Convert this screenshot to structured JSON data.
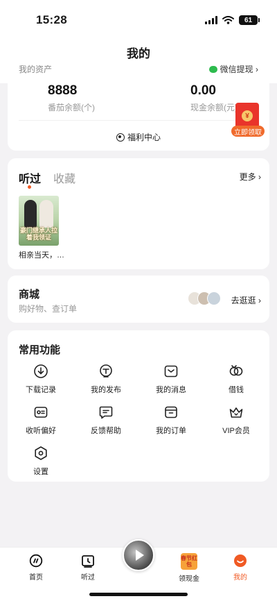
{
  "status": {
    "time": "15:28",
    "battery": "61"
  },
  "nav": {
    "title": "我的"
  },
  "assets": {
    "label": "我的资产",
    "wechat_withdraw": "微信提现 ›",
    "coins": {
      "value": "8888",
      "label": "番茄余额(个)"
    },
    "cash": {
      "value": "0.00",
      "label": "现金余额(元)"
    },
    "welfare": "福利中心"
  },
  "redpacket": {
    "coin": "¥",
    "button": "立即领取"
  },
  "listen": {
    "tabs": [
      "听过",
      "收藏"
    ],
    "more": "更多 ›",
    "cover_title": "豪门继承人拉着我领证",
    "caption": "相亲当天，…"
  },
  "shop": {
    "title": "商城",
    "subtitle": "购好物、查订单",
    "go": "去逛逛 ›"
  },
  "functions": {
    "title": "常用功能",
    "items": [
      {
        "label": "下载记录",
        "icon": "download-icon"
      },
      {
        "label": "我的发布",
        "icon": "publish-icon"
      },
      {
        "label": "我的消息",
        "icon": "message-icon"
      },
      {
        "label": "借钱",
        "icon": "loan-icon"
      },
      {
        "label": "收听偏好",
        "icon": "preference-icon"
      },
      {
        "label": "反馈帮助",
        "icon": "feedback-icon"
      },
      {
        "label": "我的订单",
        "icon": "order-icon"
      },
      {
        "label": "VIP会员",
        "icon": "vip-crown-icon"
      },
      {
        "label": "设置",
        "icon": "settings-icon"
      }
    ]
  },
  "tabbar": {
    "items": [
      {
        "label": "首页",
        "icon": "home-icon"
      },
      {
        "label": "听过",
        "icon": "history-icon"
      },
      {
        "label": "领现金",
        "icon": "cash-icon"
      },
      {
        "label": "我的",
        "icon": "profile-icon"
      }
    ],
    "cash_badge": "春节红包"
  },
  "colors": {
    "accent": "#f05a24",
    "red": "#e9342b",
    "wechat": "#2dbb4e"
  }
}
